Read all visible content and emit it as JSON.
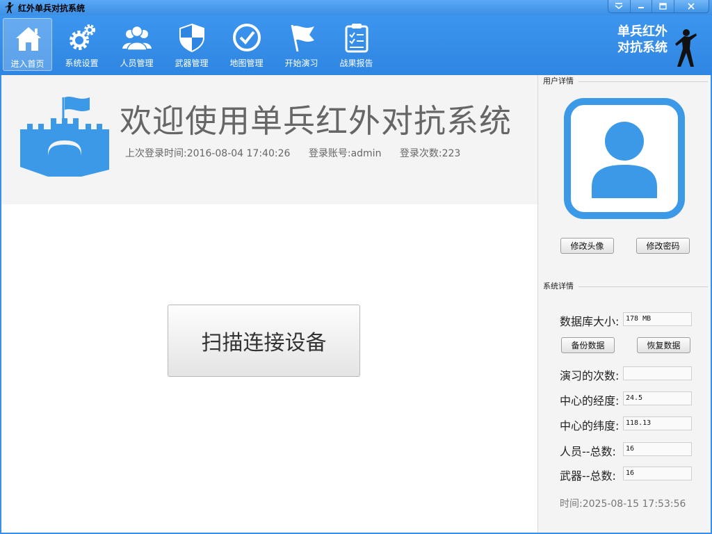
{
  "window": {
    "title": "红外单兵对抗系统"
  },
  "toolbar": {
    "items": [
      {
        "label": "进入首页",
        "icon": "home-icon"
      },
      {
        "label": "系统设置",
        "icon": "gear-icon"
      },
      {
        "label": "人员管理",
        "icon": "people-icon"
      },
      {
        "label": "武器管理",
        "icon": "shield-icon"
      },
      {
        "label": "地图管理",
        "icon": "check-circle-icon"
      },
      {
        "label": "开始演习",
        "icon": "flag-icon"
      },
      {
        "label": "战果报告",
        "icon": "clipboard-icon"
      }
    ],
    "brand_line1": "单兵红外",
    "brand_line2": "对抗系统"
  },
  "main": {
    "welcome": "欢迎使用单兵红外对抗系统",
    "last_login": "上次登录时间:2016-08-04 17:40:26",
    "account": "登录账号:admin",
    "login_count": "登录次数:223",
    "scan_button": "扫描连接设备"
  },
  "user_panel": {
    "title": "用户详情",
    "change_avatar": "修改头像",
    "change_password": "修改密码"
  },
  "system_panel": {
    "title": "系统详情",
    "backup": "备份数据",
    "restore": "恢复数据",
    "stats": [
      {
        "label": "数据库大小:",
        "value": "178 MB"
      },
      {
        "label": "演习的次数:",
        "value": ""
      },
      {
        "label": "中心的经度:",
        "value": "24.5"
      },
      {
        "label": "中心的纬度:",
        "value": "118.13"
      },
      {
        "label": "人员--总数:",
        "value": "16"
      },
      {
        "label": "武器--总数:",
        "value": "16"
      }
    ],
    "time": "时间:2025-08-15 17:53:56"
  },
  "colors": {
    "accent": "#3a90e8",
    "icon_blue": "#3b99e8"
  }
}
